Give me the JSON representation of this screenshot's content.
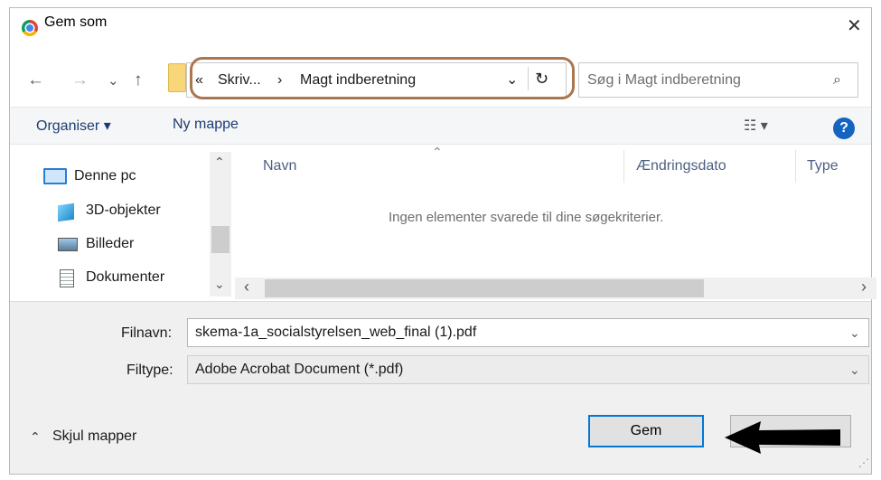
{
  "window": {
    "title": "Gem som",
    "close_glyph": "✕"
  },
  "nav": {
    "back": "←",
    "forward": "→",
    "recent": "⌄",
    "up": "↑"
  },
  "address": {
    "crumb_prefix": "«",
    "crumb1": "Skriv...",
    "separator": "›",
    "crumb2": "Magt indberetning",
    "dropdown": "⌄",
    "refresh": "↻"
  },
  "search": {
    "placeholder": "Søg i Magt indberetning",
    "icon": "⌕"
  },
  "toolbar": {
    "organize": "Organiser ▾",
    "new_folder": "Ny mappe",
    "view_icon": "☷ ▾",
    "help": "?"
  },
  "sidebar": {
    "items": [
      {
        "label": "Denne pc",
        "icon": "computer-icon"
      },
      {
        "label": "3D-objekter",
        "icon": "cube-icon"
      },
      {
        "label": "Billeder",
        "icon": "pictures-icon"
      },
      {
        "label": "Dokumenter",
        "icon": "documents-icon"
      }
    ],
    "scroll_up": "⌃",
    "scroll_down": "⌄"
  },
  "file_list": {
    "sort_arrow": "⌃",
    "columns": [
      "Navn",
      "Ændringsdato",
      "Type"
    ],
    "empty_message": "Ingen elementer svarede til dine søgekriterier.",
    "scroll_left": "‹",
    "scroll_right": "›"
  },
  "form": {
    "filename_label": "Filnavn:",
    "filename_value": "skema-1a_socialstyrelsen_web_final (1).pdf",
    "filetype_label": "Filtype:",
    "filetype_value": "Adobe Acrobat Document (*.pdf)",
    "dropdown": "⌄"
  },
  "footer": {
    "hide_folders": "Skjul mapper",
    "hide_folders_icon": "⌃",
    "save": "Gem",
    "resize_grip": "⋰"
  },
  "annotations": {
    "highlight_color": "#a9764f",
    "arrow_color": "#000000"
  },
  "colors": {
    "accent": "#0078d7",
    "help": "#1565c0",
    "link_text": "#1e3c72"
  }
}
